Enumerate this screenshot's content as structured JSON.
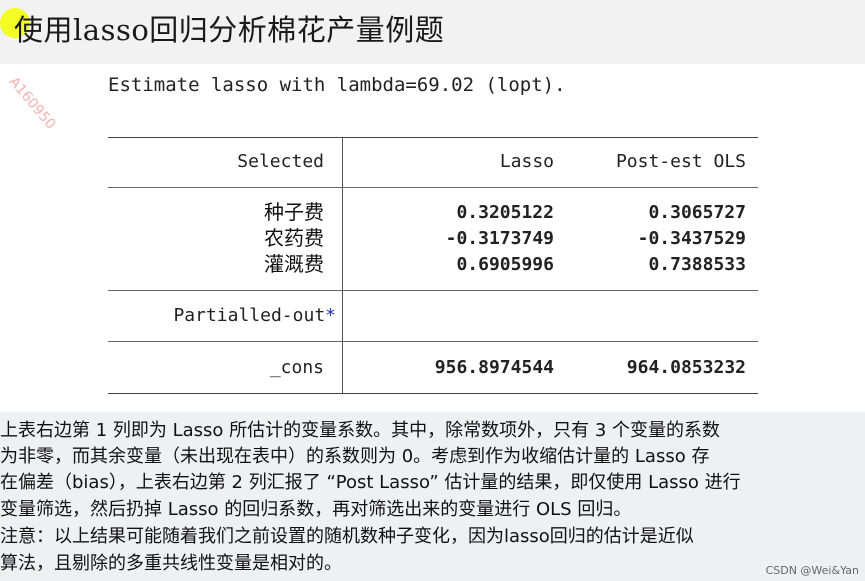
{
  "slide": {
    "title": "使用lasso回归分析棉花产量例题",
    "watermark": "A160950",
    "estimate_line": "Estimate lasso with lambda=69.02 (lopt)."
  },
  "table": {
    "headers": {
      "selected": "Selected",
      "lasso": "Lasso",
      "post_ols": "Post-est OLS"
    },
    "rows": [
      {
        "name": "种子费",
        "lasso": "0.3205122",
        "ols": "0.3065727"
      },
      {
        "name": "农药费",
        "lasso": "-0.3173749",
        "ols": "-0.3437529"
      },
      {
        "name": "灌溉费",
        "lasso": "0.6905996",
        "ols": "0.7388533"
      }
    ],
    "partialled_out": "Partialled-out",
    "partialled_star": "*",
    "cons": {
      "name": "_cons",
      "lasso": "956.8974544",
      "ols": "964.0853232"
    }
  },
  "notes": [
    "上表右边第 1 列即为 Lasso 所估计的变量系数。其中，除常数项外，只有 3 个变量的系数",
    "为非零，而其余变量（未出现在表中）的系数则为 0。考虑到作为收缩估计量的 Lasso 存",
    "在偏差（bias），上表右边第 2 列汇报了 “Post Lasso” 估计量的结果，即仅使用 Lasso 进行",
    "变量筛选，然后扔掉 Lasso 的回归系数，再对筛选出来的变量进行 OLS 回归。",
    "注意：以上结果可能随着我们之前设置的随机数种子变化，因为lasso回归的估计是近似",
    "算法，且剔除的多重共线性变量是相对的。"
  ],
  "credit": "CSDN @Wei&Yan"
}
